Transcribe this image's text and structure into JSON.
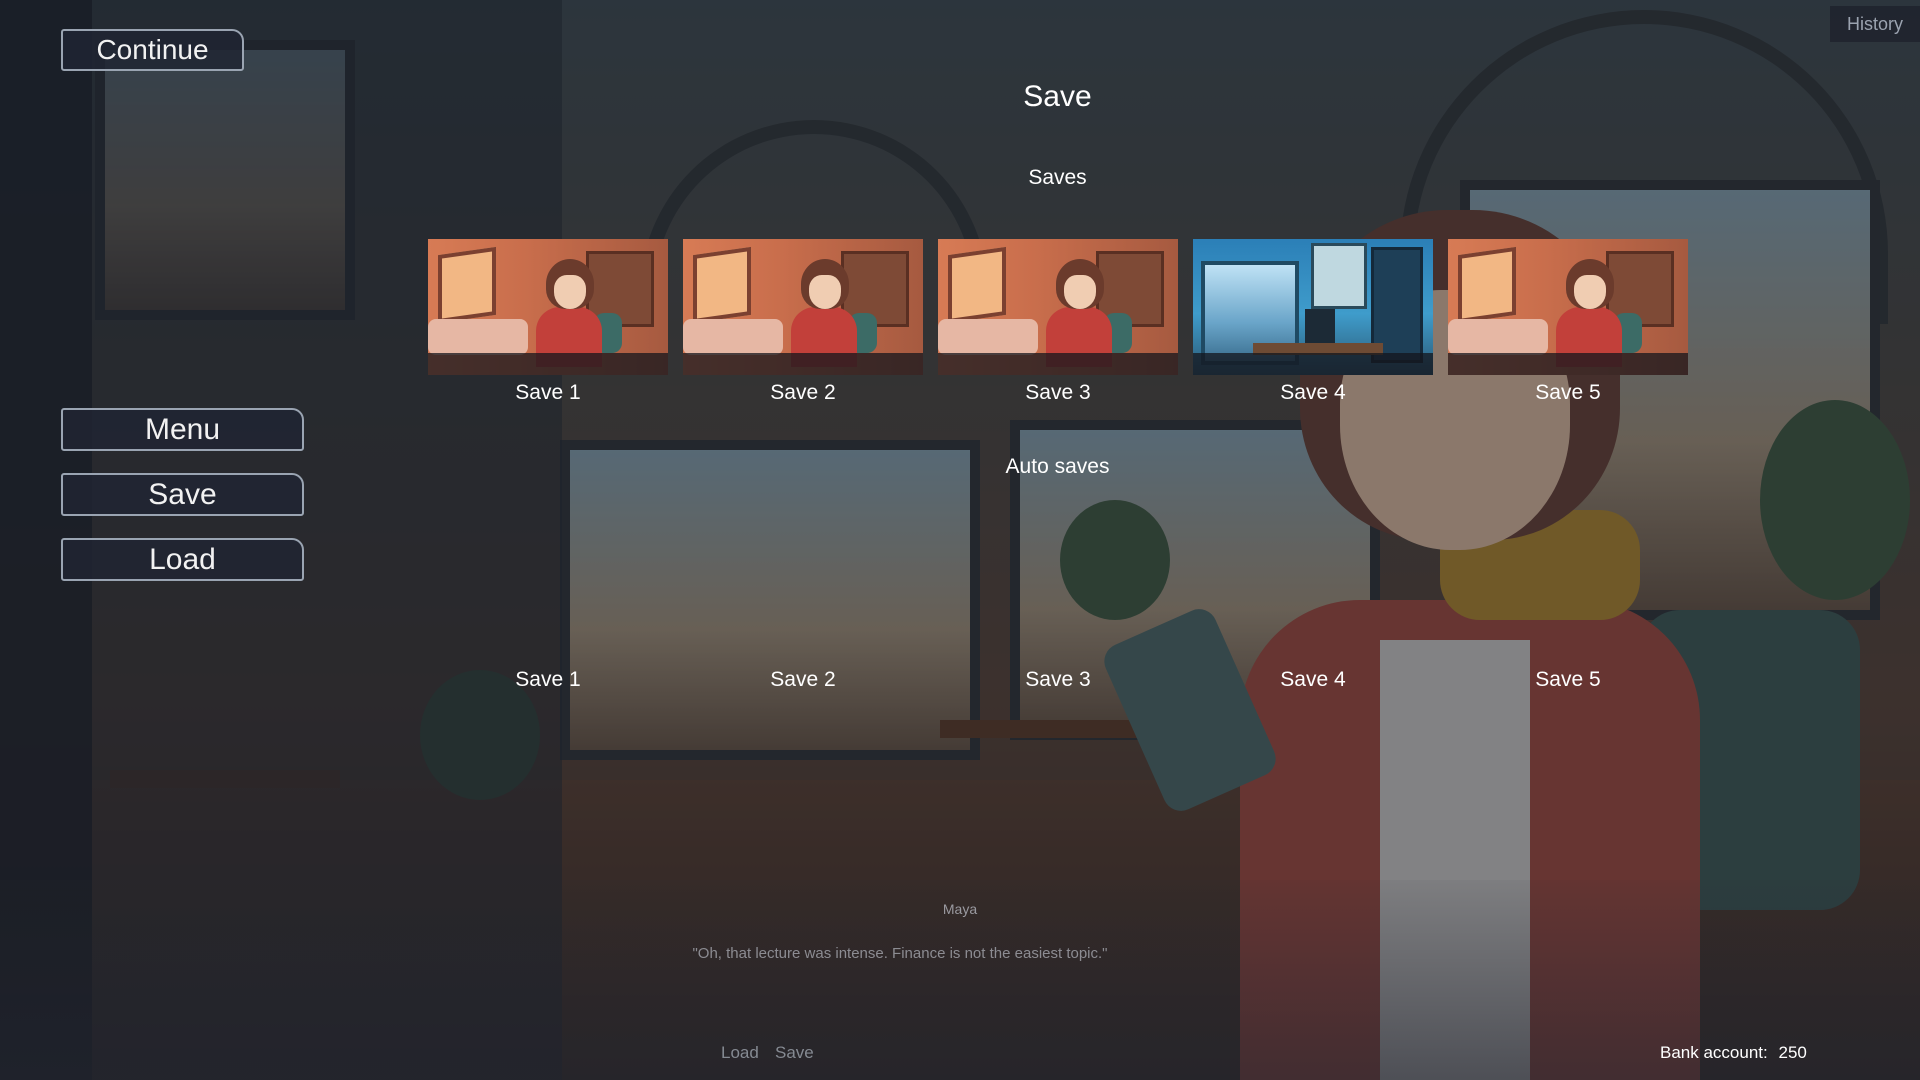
{
  "history_button": "History",
  "continue_button": "Continue",
  "sidebar_menu": [
    {
      "label": "Menu"
    },
    {
      "label": "Save"
    },
    {
      "label": "Load"
    }
  ],
  "screen_title": "Save",
  "saves_section": {
    "heading": "Saves",
    "slots": [
      {
        "label": "Save 1",
        "thumbnail": "bedroom-scene"
      },
      {
        "label": "Save 2",
        "thumbnail": "bedroom-scene"
      },
      {
        "label": "Save 3",
        "thumbnail": "bedroom-scene"
      },
      {
        "label": "Save 4",
        "thumbnail": "blue-room-scene"
      },
      {
        "label": "Save 5",
        "thumbnail": "bedroom-scene"
      }
    ]
  },
  "auto_saves_section": {
    "heading": "Auto saves",
    "slots": [
      {
        "label": "Save 1"
      },
      {
        "label": "Save 2"
      },
      {
        "label": "Save 3"
      },
      {
        "label": "Save 4"
      },
      {
        "label": "Save 5"
      }
    ]
  },
  "dialogue": {
    "speaker": "Maya",
    "text": "\"Oh, that lecture was intense. Finance is not the easiest topic.\""
  },
  "quick_menu": {
    "load": "Load",
    "save": "Save"
  },
  "bank": {
    "label": "Bank account:",
    "value": "250"
  }
}
